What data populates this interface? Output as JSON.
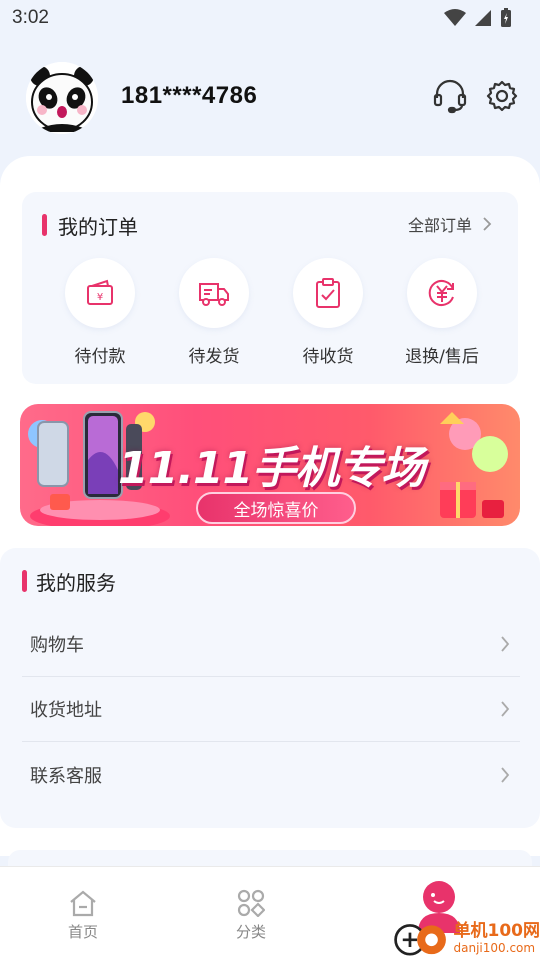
{
  "status_bar": {
    "time": "3:02"
  },
  "profile": {
    "phone": "181****4786"
  },
  "orders": {
    "title": "我的订单",
    "view_all": "全部订单",
    "items": [
      {
        "label": "待付款",
        "icon": "wallet-icon"
      },
      {
        "label": "待发货",
        "icon": "truck-icon"
      },
      {
        "label": "待收货",
        "icon": "clipboard-check-icon"
      },
      {
        "label": "退换/售后",
        "icon": "yuan-refund-icon"
      }
    ]
  },
  "banner": {
    "title": "11.11手机专场",
    "subtitle": "全场惊喜价"
  },
  "services": {
    "title": "我的服务",
    "items": [
      {
        "label": "购物车"
      },
      {
        "label": "收货地址"
      },
      {
        "label": "联系客服"
      }
    ]
  },
  "bottom_nav": {
    "items": [
      {
        "label": "首页",
        "icon": "home-icon"
      },
      {
        "label": "分类",
        "icon": "category-icon"
      },
      {
        "label": "",
        "icon": "profile-icon",
        "active": true
      }
    ]
  },
  "watermark": {
    "cn": "单机100网",
    "en": "danji100.com"
  },
  "colors": {
    "accent": "#e8336b",
    "background": "#eef3fc",
    "card": "#f4f7fd"
  }
}
